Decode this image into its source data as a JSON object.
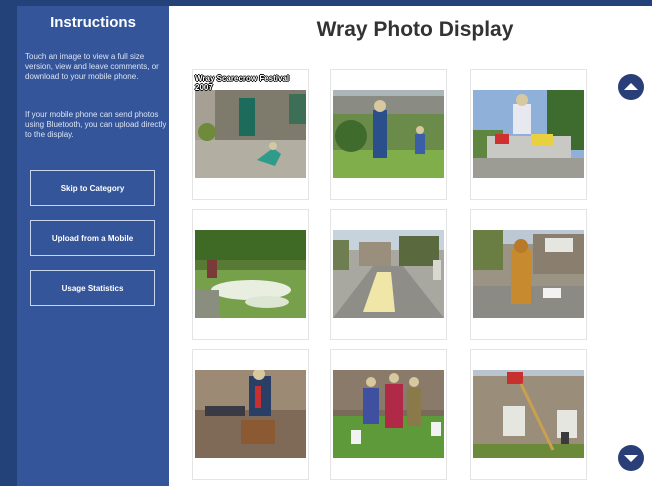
{
  "sidebar": {
    "title": "Instructions",
    "text1": "Touch an image to view a full size version, view and leave comments, or download to your mobile phone.",
    "text2": "If your mobile phone can send photos using Bluetooth, you can upload directly to the display.",
    "buttons": {
      "skip": "Skip to Category",
      "upload": "Upload from a Mobile",
      "stats": "Usage Statistics"
    }
  },
  "main": {
    "title": "Wray Photo Display",
    "first_photo_caption": "Wray Scarecrow Festival 2007"
  },
  "colors": {
    "sidebar": "#34559a",
    "nav_button": "#2a3f78",
    "edge": "#24427a"
  },
  "icons": {
    "scroll_up": "chevron-up-icon",
    "scroll_down": "chevron-down-icon"
  }
}
